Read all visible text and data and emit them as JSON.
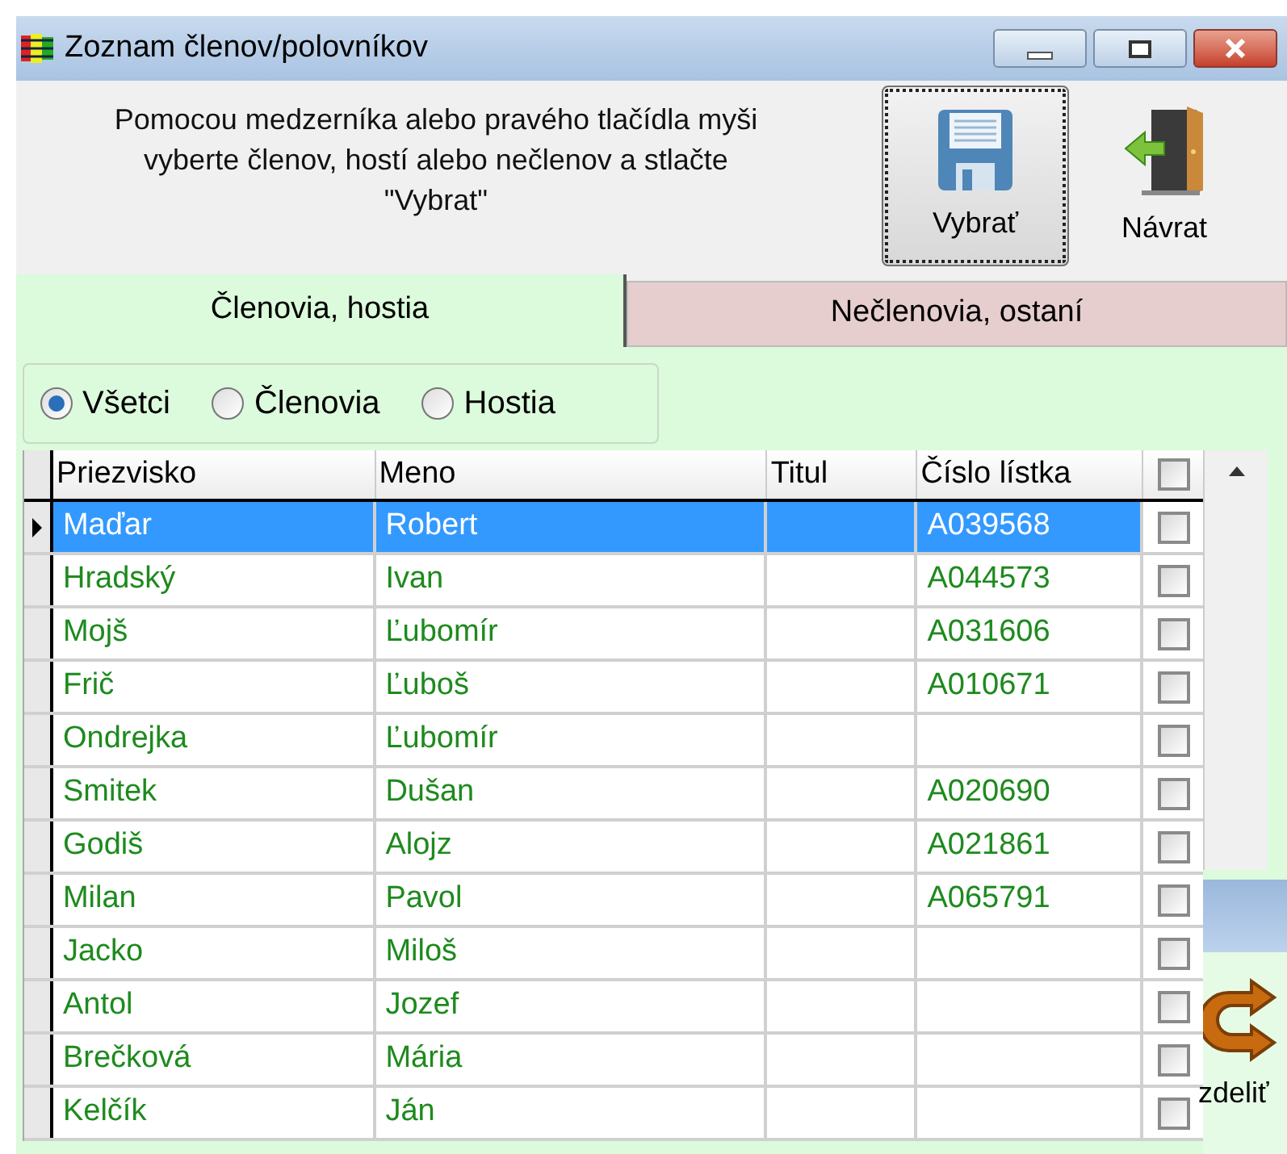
{
  "window": {
    "title": "Zoznam členov/polovníkov"
  },
  "instructions": "Pomocou medzerníka alebo pravého tlačídla myši vyberte členov, hostí alebo nečlenov a stlačte   \"Vybrat\"",
  "toolbar": [
    {
      "kind": "save",
      "label": "Vybrať",
      "focused": true
    },
    {
      "kind": "exit",
      "label": "Návrat",
      "focused": false
    }
  ],
  "tabs": [
    {
      "label": "Členovia, hostia",
      "selected": true
    },
    {
      "label": "Nečlenovia, ostaní",
      "selected": false
    }
  ],
  "filter": [
    {
      "label": "Všetci",
      "selected": true
    },
    {
      "label": "Členovia",
      "selected": false
    },
    {
      "label": "Hostia",
      "selected": false
    }
  ],
  "table": {
    "columns": [
      "Priezvisko",
      "Meno",
      "Titul",
      "Číslo lístka"
    ],
    "header_checked": false,
    "rows": [
      {
        "cells": [
          "Maďar",
          "Robert",
          "",
          "A039568"
        ],
        "selected": true,
        "checked": false
      },
      {
        "cells": [
          "Hradský",
          "Ivan",
          "",
          "A044573"
        ],
        "selected": false,
        "checked": false
      },
      {
        "cells": [
          "Mojš",
          "Ľubomír",
          "",
          "A031606"
        ],
        "selected": false,
        "checked": false
      },
      {
        "cells": [
          "Frič",
          "Ľuboš",
          "",
          "A010671"
        ],
        "selected": false,
        "checked": false
      },
      {
        "cells": [
          "Ondrejka",
          "Ľubomír",
          "",
          ""
        ],
        "selected": false,
        "checked": false
      },
      {
        "cells": [
          "Smitek",
          "Dušan",
          "",
          "A020690"
        ],
        "selected": false,
        "checked": false
      },
      {
        "cells": [
          "Godiš",
          "Alojz",
          "",
          "A021861"
        ],
        "selected": false,
        "checked": false
      },
      {
        "cells": [
          "Milan",
          "Pavol",
          "",
          "A065791"
        ],
        "selected": false,
        "checked": false
      },
      {
        "cells": [
          "Jacko",
          "Miloš",
          "",
          ""
        ],
        "selected": false,
        "checked": false
      },
      {
        "cells": [
          "Antol",
          "Jozef",
          "",
          ""
        ],
        "selected": false,
        "checked": false
      },
      {
        "cells": [
          "Brečková",
          "Mária",
          "",
          ""
        ],
        "selected": false,
        "checked": false
      },
      {
        "cells": [
          "Kelčík",
          "Ján",
          "",
          ""
        ],
        "selected": false,
        "checked": false
      }
    ]
  },
  "overlay_window": {
    "button_label": "zdeliť"
  }
}
